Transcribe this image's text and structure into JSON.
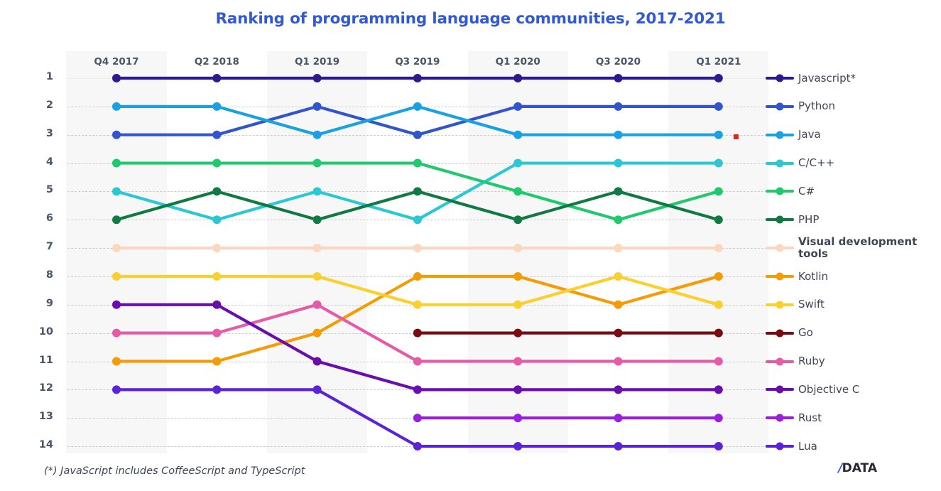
{
  "title": "Ranking of programming language communities, 2017-2021",
  "footnote": "(*) JavaScript includes CoffeeScript and TypeScript",
  "logo": {
    "slash": "/",
    "word": "DATA"
  },
  "axis": {
    "y_ticks": [
      "1",
      "2",
      "3",
      "4",
      "5",
      "6",
      "7",
      "8",
      "9",
      "10",
      "11",
      "12",
      "13",
      "14"
    ]
  },
  "chart_data": {
    "type": "line",
    "title": "Ranking of programming language communities, 2017-2021",
    "subtitle": "",
    "xlabel": "",
    "ylabel": "",
    "categories": [
      "Q4 2017",
      "Q2 2018",
      "Q1 2019",
      "Q3 2019",
      "Q1 2020",
      "Q3 2020",
      "Q1 2021"
    ],
    "ylim": [
      1,
      14
    ],
    "y_inverted": true,
    "grid": true,
    "legend_position": "right",
    "annotations": [
      "(*) JavaScript includes CoffeeScript and TypeScript"
    ],
    "series": [
      {
        "name": "Javascript*",
        "color": "#2E1A8C",
        "values": [
          1,
          1,
          1,
          1,
          1,
          1,
          1
        ]
      },
      {
        "name": "Python",
        "color": "#3355CC",
        "values": [
          3,
          3,
          2,
          3,
          2,
          2,
          2
        ]
      },
      {
        "name": "Java",
        "color": "#1CA1E0",
        "values": [
          2,
          2,
          3,
          2,
          3,
          3,
          3
        ]
      },
      {
        "name": "C/C++",
        "color": "#2BC8D4",
        "values": [
          5,
          6,
          5,
          6,
          4,
          4,
          4
        ]
      },
      {
        "name": "C#",
        "color": "#20C96E",
        "values": [
          4,
          4,
          4,
          4,
          5,
          6,
          5
        ]
      },
      {
        "name": "PHP",
        "color": "#117A42",
        "values": [
          6,
          5,
          6,
          5,
          6,
          5,
          6
        ]
      },
      {
        "name": "Visual development tools",
        "color": "#FAD8C0",
        "values": [
          7,
          7,
          7,
          7,
          7,
          7,
          7
        ]
      },
      {
        "name": "Kotlin",
        "color": "#F59B05",
        "values": [
          11,
          11,
          10,
          8,
          8,
          9,
          8
        ]
      },
      {
        "name": "Swift",
        "color": "#FBD02E",
        "values": [
          8,
          8,
          8,
          9,
          9,
          8,
          9
        ]
      },
      {
        "name": "Go",
        "color": "#7A0A12",
        "values": [
          null,
          null,
          null,
          10,
          10,
          10,
          10
        ]
      },
      {
        "name": "Ruby",
        "color": "#E55BA8",
        "values": [
          10,
          10,
          9,
          11,
          11,
          11,
          11
        ]
      },
      {
        "name": "Objective C",
        "color": "#6A0DAD",
        "values": [
          9,
          9,
          11,
          12,
          12,
          12,
          12
        ]
      },
      {
        "name": "Rust",
        "color": "#9B1FE0",
        "values": [
          null,
          null,
          null,
          13,
          13,
          13,
          13
        ]
      },
      {
        "name": "Lua",
        "color": "#5B23D6",
        "values": [
          12,
          12,
          12,
          14,
          14,
          14,
          14
        ]
      }
    ],
    "legend": [
      {
        "label": "Javascript*",
        "color": "#2E1A8C"
      },
      {
        "label": "Python",
        "color": "#3355CC"
      },
      {
        "label": "Java",
        "color": "#1CA1E0"
      },
      {
        "label": "C/C++",
        "color": "#2BC8D4"
      },
      {
        "label": "C#",
        "color": "#20C96E"
      },
      {
        "label": "PHP",
        "color": "#117A42"
      },
      {
        "label": "Visual development\ntools",
        "color": "#FAD8C0"
      },
      {
        "label": "Kotlin",
        "color": "#F59B05"
      },
      {
        "label": "Swift",
        "color": "#FBD02E"
      },
      {
        "label": "Go",
        "color": "#7A0A12"
      },
      {
        "label": "Ruby",
        "color": "#E55BA8"
      },
      {
        "label": "Objective C",
        "color": "#6A0DAD"
      },
      {
        "label": "Rust",
        "color": "#9B1FE0"
      },
      {
        "label": "Lua",
        "color": "#5B23D6"
      }
    ],
    "colors": {
      "title": "#3159D1",
      "tick_label": "#4A5568",
      "gridline": "#C9CCD1",
      "band": "#F7F7F7",
      "background": "#FFFFFF",
      "stray_marker": "#E8211C"
    }
  }
}
